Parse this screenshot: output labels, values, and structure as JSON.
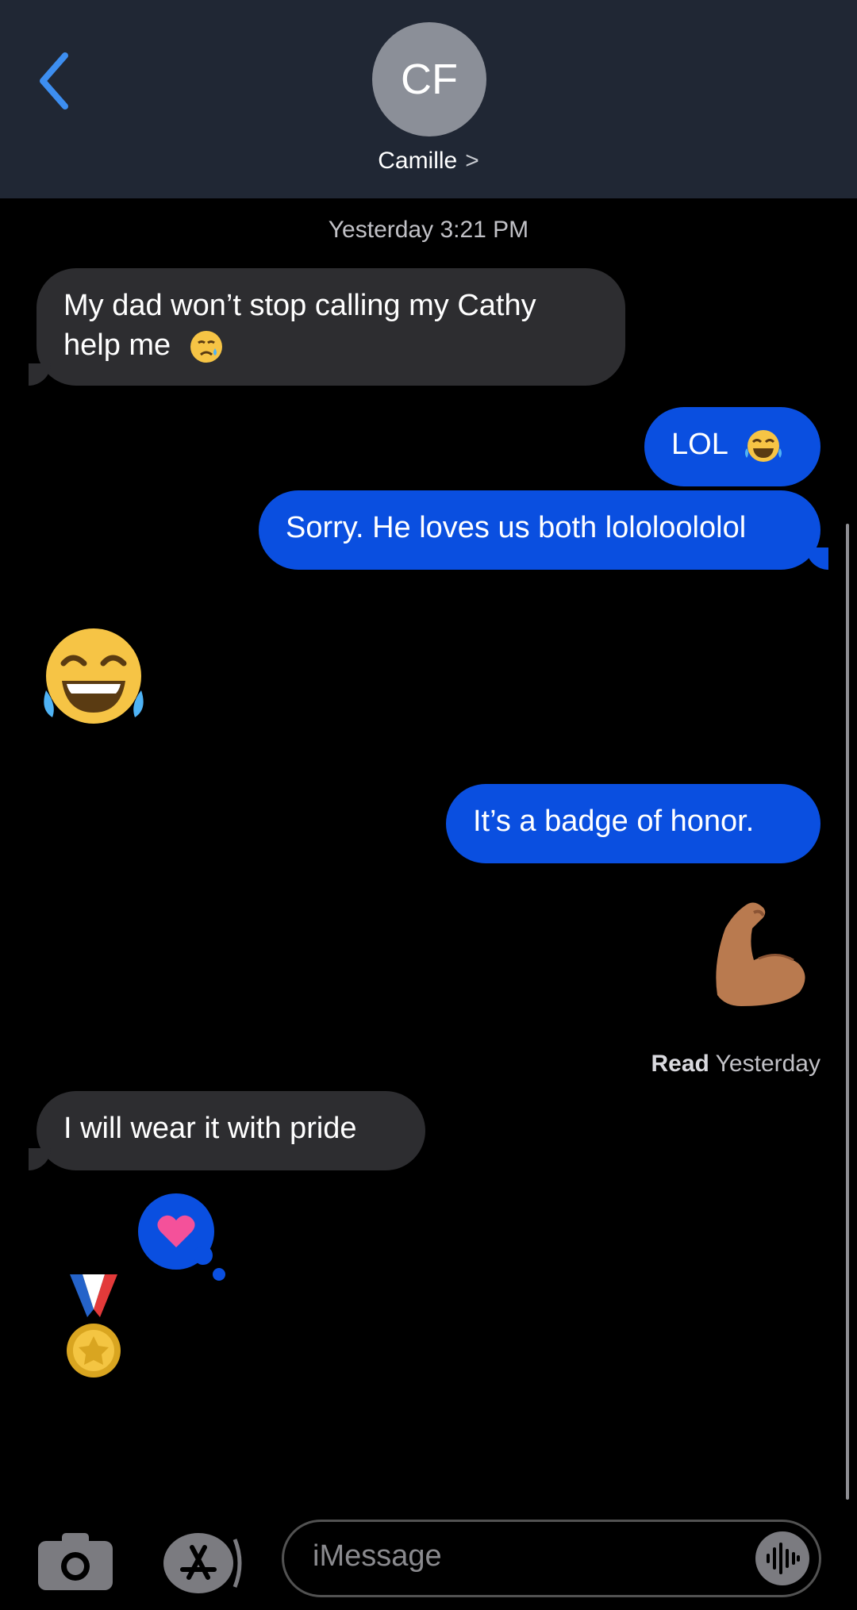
{
  "header": {
    "avatar_initials": "CF",
    "contact_name": "Camille",
    "chevron": ">"
  },
  "timestamp": "Yesterday 3:21 PM",
  "messages": [
    {
      "side": "received",
      "text_line1": "My dad won’t stop calling my Cathy",
      "text_line2": "help me"
    },
    {
      "side": "sent",
      "text": "LOL"
    },
    {
      "side": "sent",
      "text": "Sorry. He loves us both lololoololol"
    },
    {
      "side": "received",
      "type": "emoji",
      "emoji": "tears-of-joy"
    },
    {
      "side": "sent",
      "text": "It’s a badge of honor."
    },
    {
      "side": "sent",
      "type": "emoji",
      "emoji": "flexed-biceps"
    },
    {
      "side": "received",
      "text": "I will wear it with pride"
    },
    {
      "side": "received",
      "type": "emoji",
      "emoji": "medal"
    }
  ],
  "receipt": {
    "bold": "Read",
    "text": "Yesterday"
  },
  "reaction": {
    "type": "heart",
    "color": "#f4519a"
  },
  "input": {
    "placeholder": "iMessage"
  },
  "colors": {
    "header_bg": "#202734",
    "sent_bubble": "#0a4fe0",
    "received_bubble": "#2d2d30",
    "accent": "#3d8ef0"
  }
}
